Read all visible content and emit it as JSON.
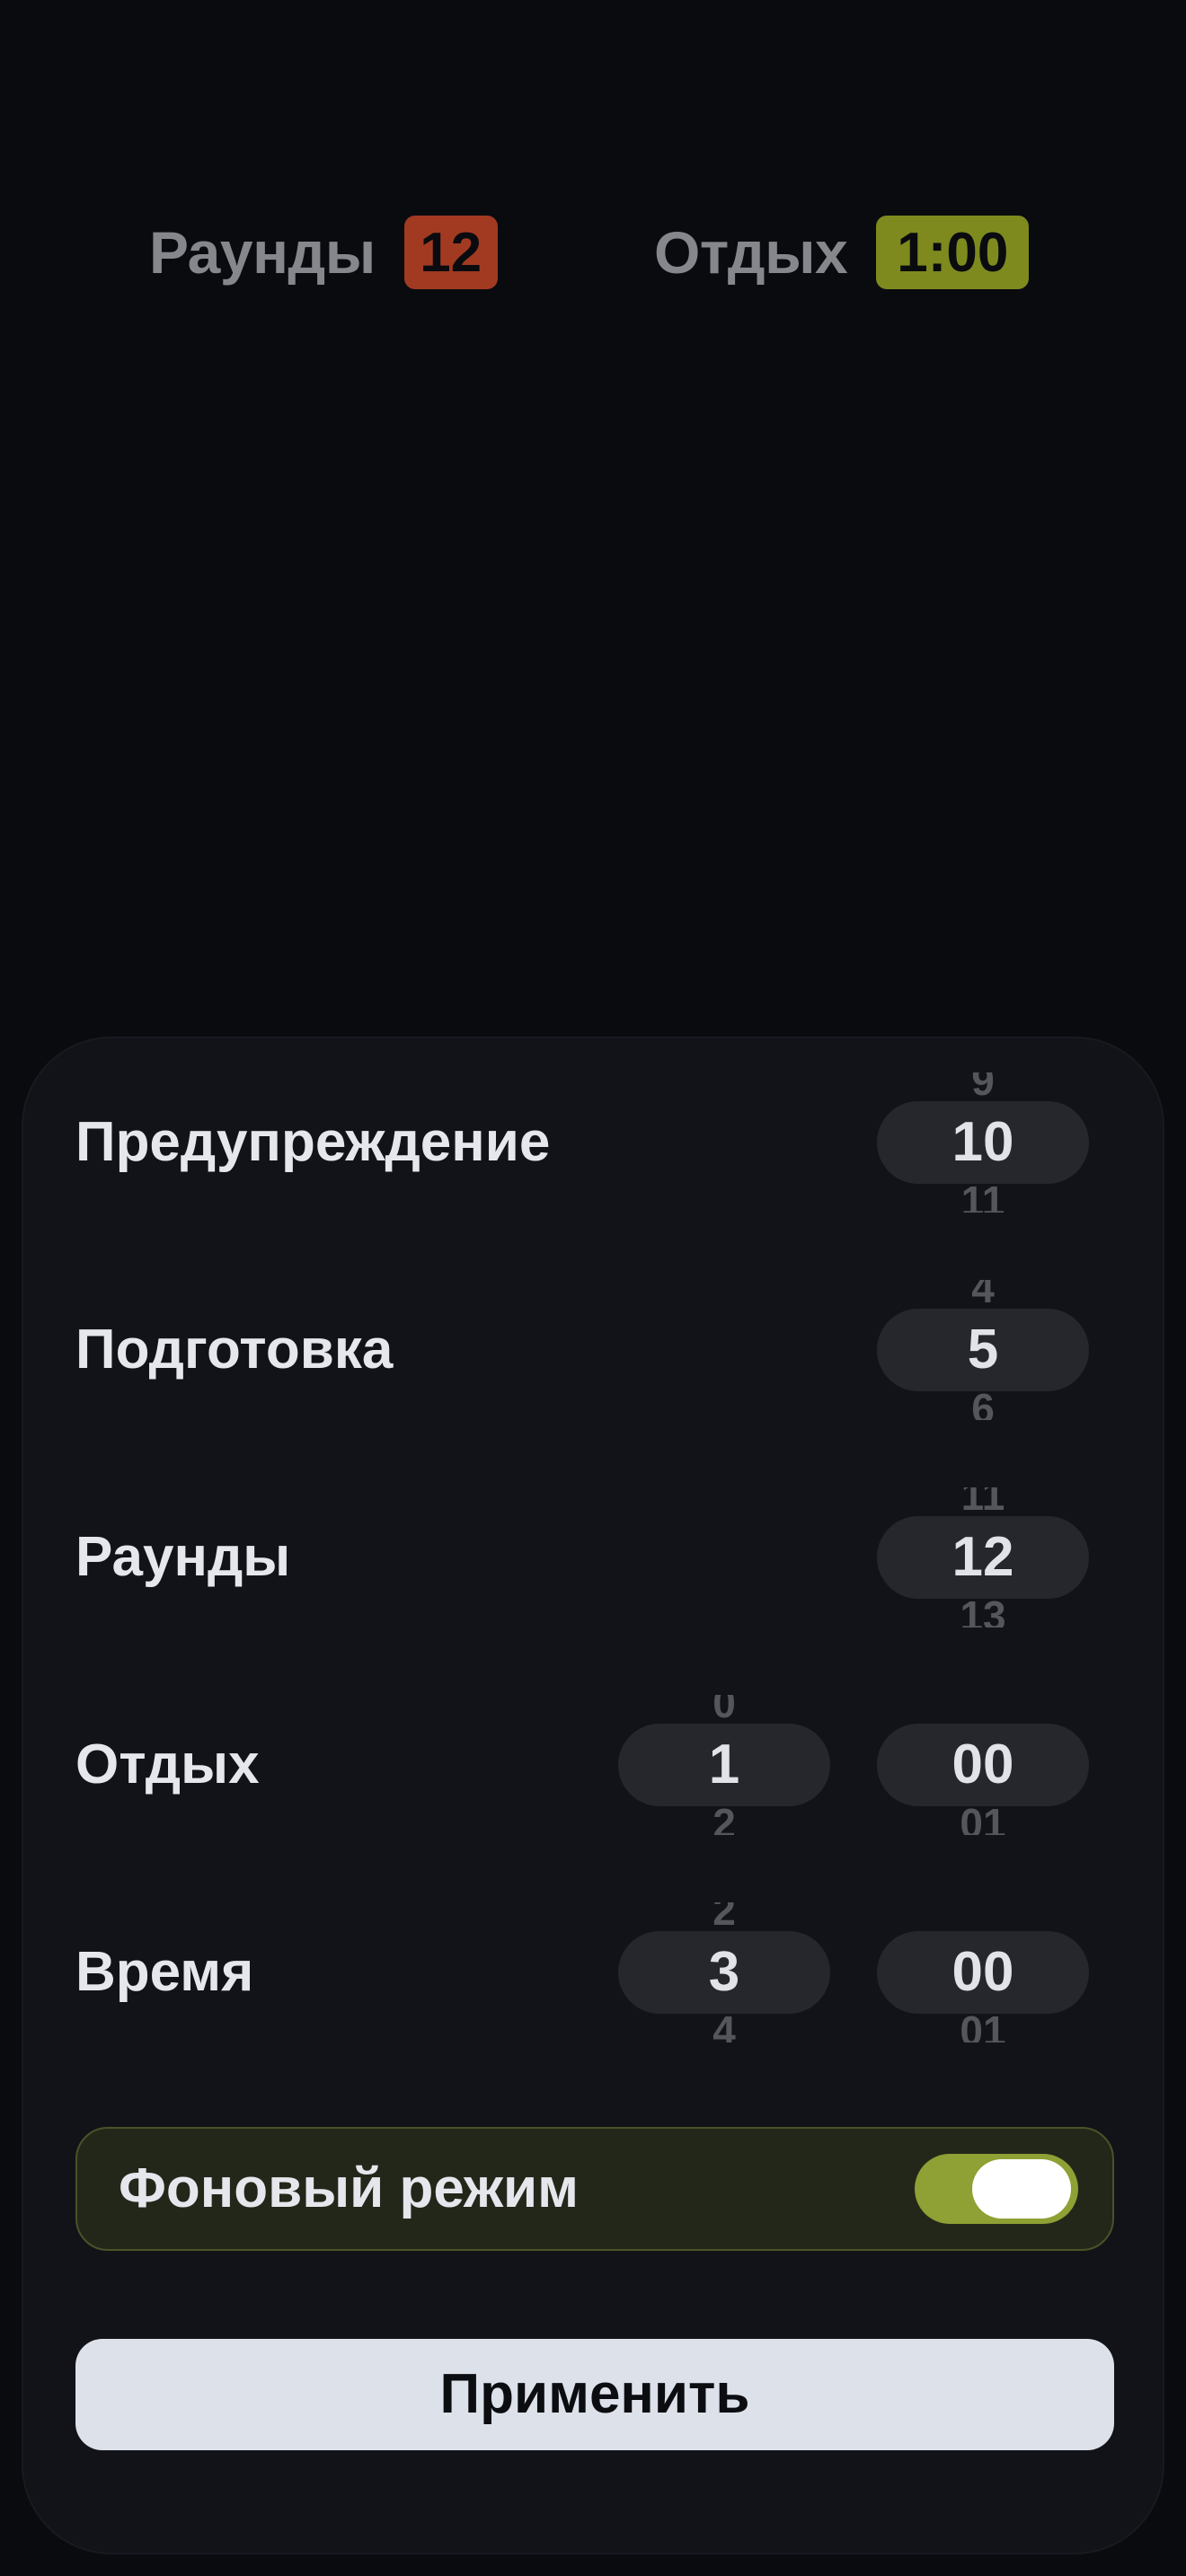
{
  "header": {
    "rounds": {
      "label": "Раунды",
      "value": "12",
      "color": "#a23a22"
    },
    "rest": {
      "label": "Отдых",
      "value": "1:00",
      "color": "#7e8a1e"
    }
  },
  "settings": {
    "warning": {
      "label": "Предупреждение",
      "prev": "9",
      "value": "10",
      "next": "11"
    },
    "prep": {
      "label": "Подготовка",
      "prev": "4",
      "value": "5",
      "next": "6"
    },
    "rounds": {
      "label": "Раунды",
      "prev": "11",
      "value": "12",
      "next": "13"
    },
    "rest": {
      "label": "Отдых",
      "minutes": {
        "prev": "0",
        "value": "1",
        "next": "2"
      },
      "seconds": {
        "value": "00",
        "next": "01"
      }
    },
    "time": {
      "label": "Время",
      "minutes": {
        "prev": "2",
        "value": "3",
        "next": "4"
      },
      "seconds": {
        "value": "00",
        "next": "01"
      }
    }
  },
  "background_mode": {
    "label": "Фоновый режим",
    "enabled": true,
    "accent": "#8fa034"
  },
  "apply_button": {
    "label": "Применить"
  }
}
